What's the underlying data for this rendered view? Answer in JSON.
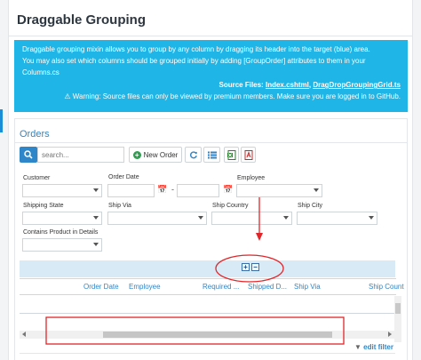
{
  "page": {
    "title": "Draggable Grouping"
  },
  "info": {
    "line1": "Draggable grouping mixin allows you to group by any column by dragging its header into the target (blue) area.",
    "line2": "You may also set which columns should be grouped initially by adding [GroupOrder] attributes to them in your",
    "line3": "Columns.cs",
    "files_label": "Source Files:",
    "file1": "Index.cshtml",
    "file2": "DragDropGroupingGrid.ts",
    "warning": "Warning: Source files can only be viewed by premium members. Make sure you are logged in to GitHub."
  },
  "orders": {
    "title": "Orders",
    "search_placeholder": "search...",
    "new_order_label": "New Order"
  },
  "filters": {
    "customer": "Customer",
    "order_date": "Order Date",
    "date_dash": "-",
    "employee": "Employee",
    "shipping_state": "Shipping State",
    "ship_via": "Ship Via",
    "ship_country": "Ship Country",
    "ship_city": "Ship City",
    "contains_product": "Contains Product in Details"
  },
  "grid": {
    "columns": [
      "Order Date",
      "Employee",
      "Required ...",
      "Shipped D...",
      "Ship Via",
      "Ship Count"
    ]
  },
  "footer": {
    "edit_filter": "edit filter"
  },
  "colors": {
    "info_bg": "#1fb5e6",
    "accent": "#2f86c8",
    "group_zone": "#d9eaf7",
    "annotation": "#e0262a"
  },
  "icons": [
    "search-icon",
    "plus-circle-icon",
    "refresh-icon",
    "column-list-icon",
    "excel-icon",
    "pdf-icon",
    "calendar-icon",
    "expand-all-icon",
    "collapse-all-icon",
    "funnel-icon",
    "warning-icon"
  ]
}
